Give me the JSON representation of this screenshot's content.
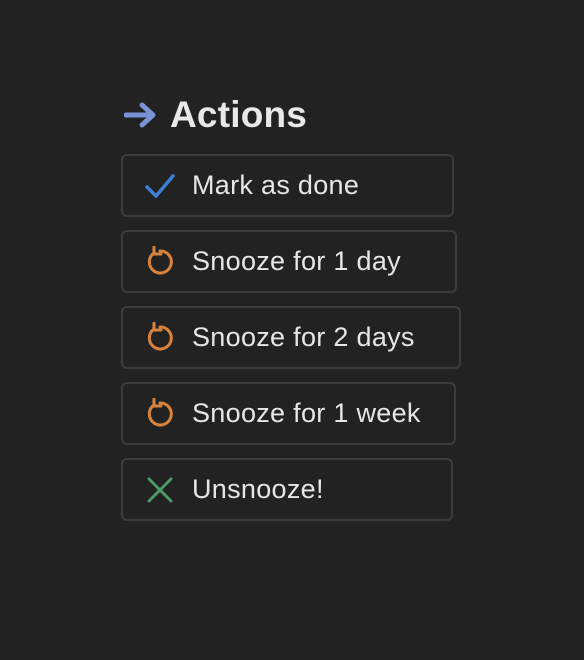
{
  "section": {
    "title": "Actions",
    "icon": "right-arrow-icon",
    "icon_color": "#7a92d6"
  },
  "actions": [
    {
      "label": "Mark as done",
      "icon": "checkmark-icon",
      "icon_color": "#3d7fd6"
    },
    {
      "label": "Snooze for 1 day",
      "icon": "snooze-icon",
      "icon_color": "#d9823b"
    },
    {
      "label": "Snooze for 2 days",
      "icon": "snooze-icon",
      "icon_color": "#d9823b"
    },
    {
      "label": "Snooze for 1 week",
      "icon": "snooze-icon",
      "icon_color": "#d9823b"
    },
    {
      "label": "Unsnooze!",
      "icon": "cross-icon",
      "icon_color": "#4f9a6b"
    }
  ]
}
